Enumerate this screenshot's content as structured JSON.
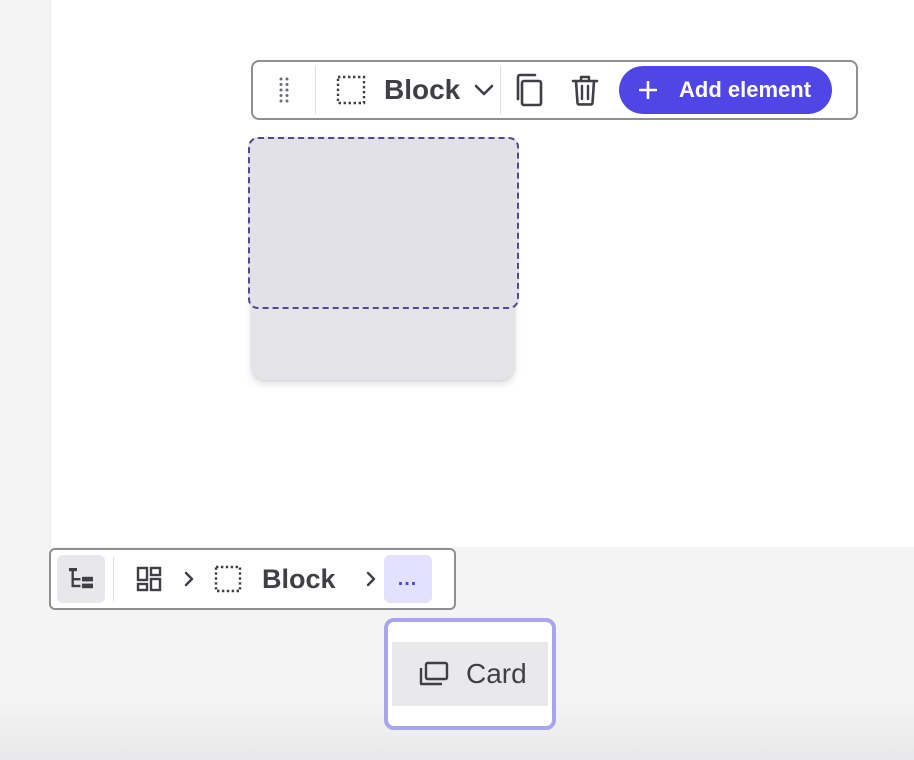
{
  "block_toolbar": {
    "type_label": "Block",
    "add_label": "Add element"
  },
  "breadcrumb": {
    "current_label": "Block",
    "more_label": "..."
  },
  "dropdown": {
    "items": [
      {
        "label": "Card"
      }
    ]
  },
  "colors": {
    "accent": "#5046e5",
    "selection_border": "#4e4a8c",
    "dropdown_border": "#a9a5ec"
  }
}
